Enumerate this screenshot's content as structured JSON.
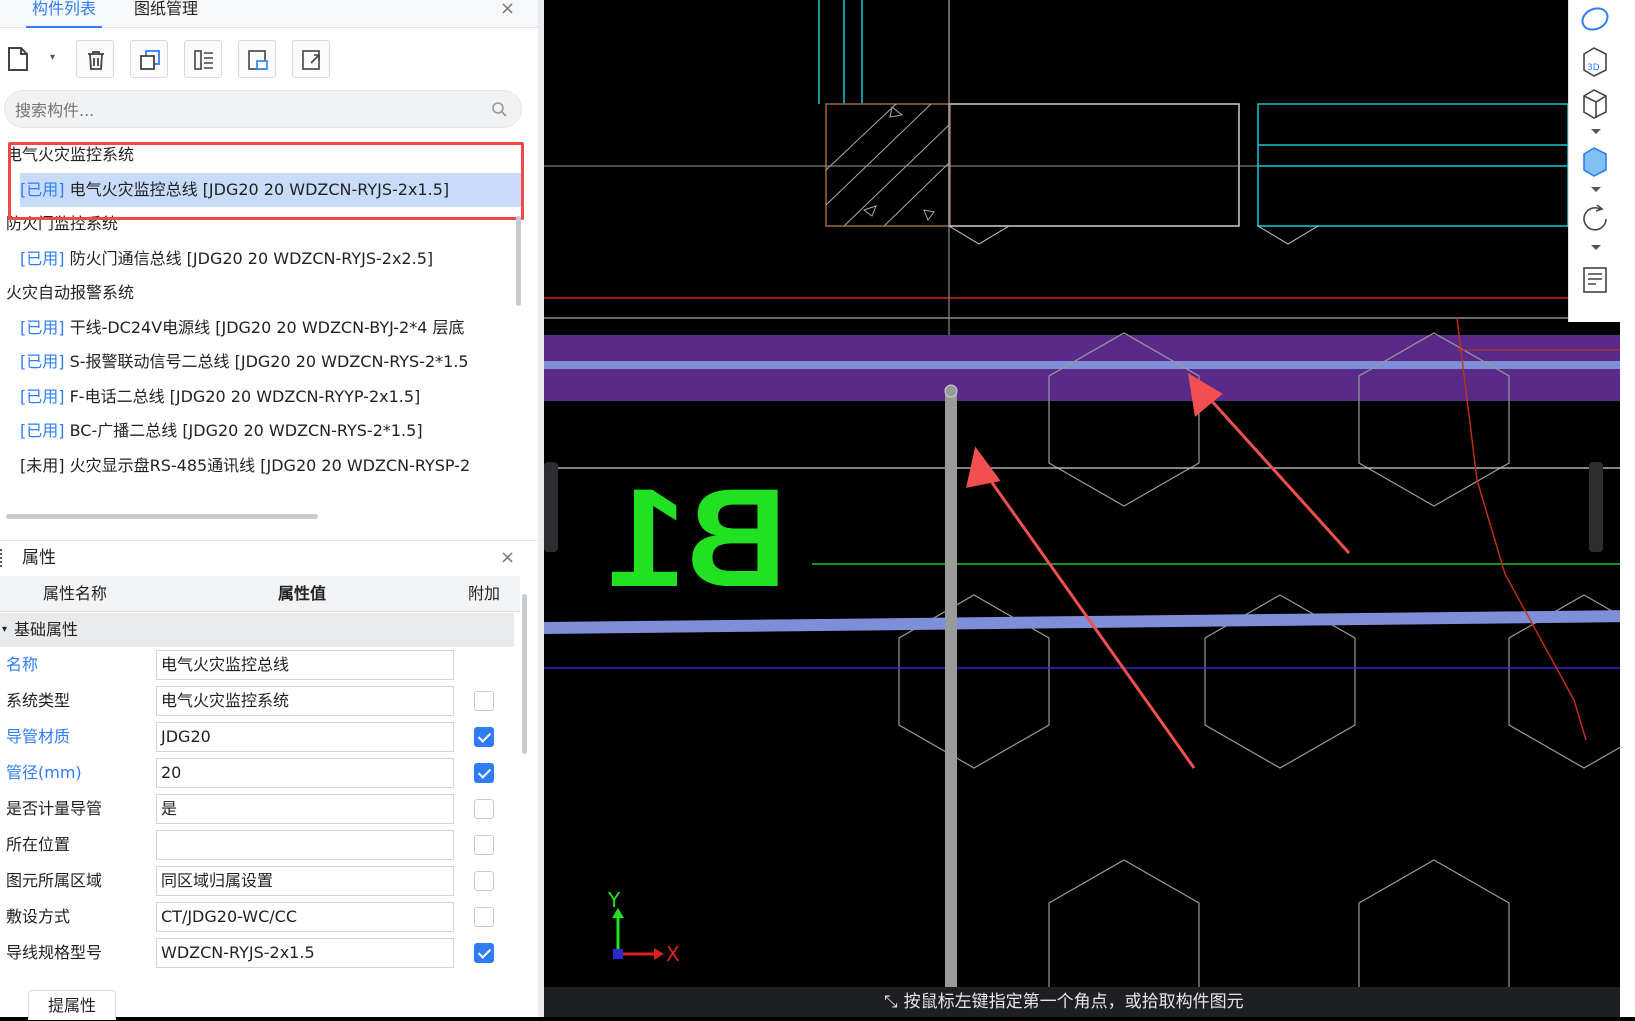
{
  "tabs": {
    "component_list": "构件列表",
    "drawing_manage": "图纸管理"
  },
  "search": {
    "placeholder": "搜索构件..."
  },
  "tree": [
    {
      "kind": "group",
      "label": "电气火灾监控系统"
    },
    {
      "kind": "item",
      "tag": "[已用]",
      "label": " 电气火灾监控总线 [JDG20 20 WDZCN-RYJS-2x1.5]",
      "selected": true
    },
    {
      "kind": "group",
      "label": "防火门监控系统"
    },
    {
      "kind": "item",
      "tag": "[已用]",
      "label": " 防火门通信总线 [JDG20 20 WDZCN-RYJS-2x2.5]"
    },
    {
      "kind": "group",
      "label": "火灾自动报警系统"
    },
    {
      "kind": "item",
      "tag": "[已用]",
      "label": " 干线-DC24V电源线 [JDG20 20 WDZCN-BYJ-2*4 层底"
    },
    {
      "kind": "item",
      "tag": "[已用]",
      "label": " S-报警联动信号二总线 [JDG20 20 WDZCN-RYS-2*1.5"
    },
    {
      "kind": "item",
      "tag": "[已用]",
      "label": " F-电话二总线 [JDG20 20 WDZCN-RYYP-2x1.5]"
    },
    {
      "kind": "item",
      "tag": "[已用]",
      "label": " BC-广播二总线 [JDG20 20 WDZCN-RYS-2*1.5]"
    },
    {
      "kind": "item",
      "tag": "[未用]",
      "label": " 火灾显示盘RS-485通讯线 [JDG20 20 WDZCN-RYSP-2",
      "unused": true
    }
  ],
  "properties": {
    "title": "属性",
    "col_name": "属性名称",
    "col_value": "属性值",
    "col_extra": "附加",
    "section": "基础属性",
    "rows": [
      {
        "name": "名称",
        "value": "电气火灾监控总线",
        "blue": true,
        "check": null
      },
      {
        "name": "系统类型",
        "value": "电气火灾监控系统",
        "blue": false,
        "check": false
      },
      {
        "name": "导管材质",
        "value": "JDG20",
        "blue": true,
        "check": true
      },
      {
        "name": "管径(mm)",
        "value": "20",
        "blue": true,
        "check": true
      },
      {
        "name": "是否计量导管",
        "value": "是",
        "blue": false,
        "check": false
      },
      {
        "name": "所在位置",
        "value": "",
        "blue": false,
        "check": false
      },
      {
        "name": "图元所属区域",
        "value": "同区域归属设置",
        "blue": false,
        "check": false
      },
      {
        "name": "敷设方式",
        "value": "CT/JDG20-WC/CC",
        "blue": false,
        "check": false
      },
      {
        "name": "导线规格型号",
        "value": "WDZCN-RYJS-2x1.5",
        "blue": false,
        "check": true
      }
    ],
    "bottom_tab": "提属性"
  },
  "canvas": {
    "label": "B1",
    "axis_x": "X",
    "axis_y": "Y",
    "status": "按鼠标左键指定第一个角点，或拾取构件图元"
  },
  "colors": {
    "accent": "#2f7df6",
    "highlight": "#f44848",
    "band": "#5a2a8a",
    "arrow": "#f25050",
    "text_green": "#22e022"
  }
}
